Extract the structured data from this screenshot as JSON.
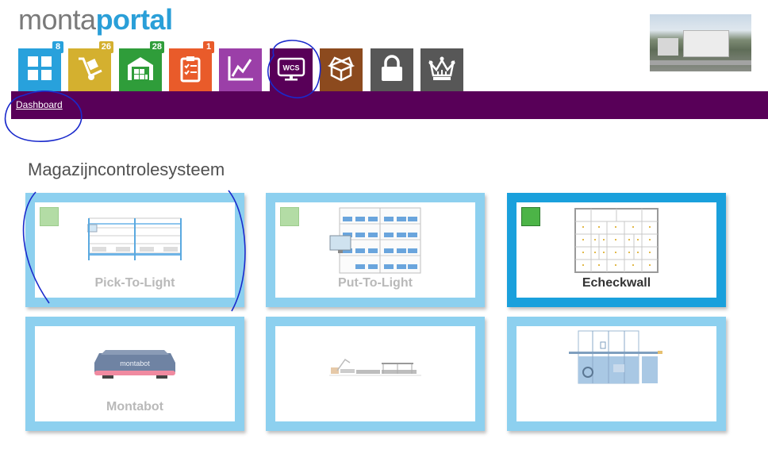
{
  "logo": {
    "part1": "monta",
    "part2": "portal"
  },
  "nav_tiles": [
    {
      "name": "dashboard",
      "icon": "grid-icon",
      "color": "#28a1dc",
      "badge": "8",
      "badge_color": "#28a1dc"
    },
    {
      "name": "inbound",
      "icon": "hand-truck-icon",
      "color": "#d4b02f",
      "badge": "26",
      "badge_color": "#d4b02f"
    },
    {
      "name": "warehouse",
      "icon": "warehouse-icon",
      "color": "#2f9d3a",
      "badge": "28",
      "badge_color": "#2f9d3a"
    },
    {
      "name": "orders",
      "icon": "clipboard-checklist-icon",
      "color": "#e95b2a",
      "badge": "1",
      "badge_color": "#e95b2a"
    },
    {
      "name": "statistics",
      "icon": "line-chart-icon",
      "color": "#9b3fa8",
      "badge": null
    },
    {
      "name": "wcs",
      "icon": "wcs-monitor-icon",
      "color": "#580058",
      "badge": null,
      "text": "WCS"
    },
    {
      "name": "shipping",
      "icon": "open-box-icon",
      "color": "#8c4a1e",
      "badge": null
    },
    {
      "name": "security",
      "icon": "lock-icon",
      "color": "#575757",
      "badge": null
    },
    {
      "name": "premium",
      "icon": "crown-icon",
      "color": "#575757",
      "badge": null
    }
  ],
  "breadcrumb": "Dashboard",
  "section_title": "Magazijncontrolesysteem",
  "cards": [
    {
      "label": "Pick-To-Light",
      "status": "light-green",
      "active": false
    },
    {
      "label": "Put-To-Light",
      "status": "light-green",
      "active": false
    },
    {
      "label": "Echeckwall",
      "status": "green",
      "active": true
    },
    {
      "label": "Montabot",
      "status": null,
      "active": false,
      "robot_text": "montabot"
    },
    {
      "label": "",
      "status": null,
      "active": false
    },
    {
      "label": "",
      "status": null,
      "active": false
    }
  ],
  "colors": {
    "navbar": "#580058",
    "card_border": "#8dd0ef",
    "card_border_active": "#1aa0dc",
    "annotation": "#1a2acc"
  }
}
